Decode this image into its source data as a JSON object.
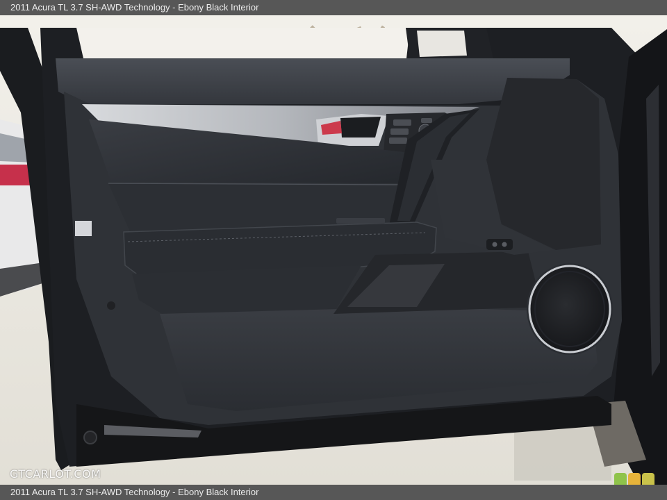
{
  "caption": "2011 Acura TL 3.7 SH-AWD Technology - Ebony Black Interior",
  "watermark": "GTCARLOT.COM",
  "photo_subject": "car-door-interior-panel",
  "colors": {
    "caption_bar": "#575757",
    "caption_text": "#ececec",
    "door_trim": "#33363b",
    "leather": "#2b2e33",
    "silver_accent": "#b9bcc2",
    "speaker_ring": "#c9ccd1",
    "badge": [
      "#8fc34a",
      "#e6b33a",
      "#c9c24a"
    ]
  }
}
